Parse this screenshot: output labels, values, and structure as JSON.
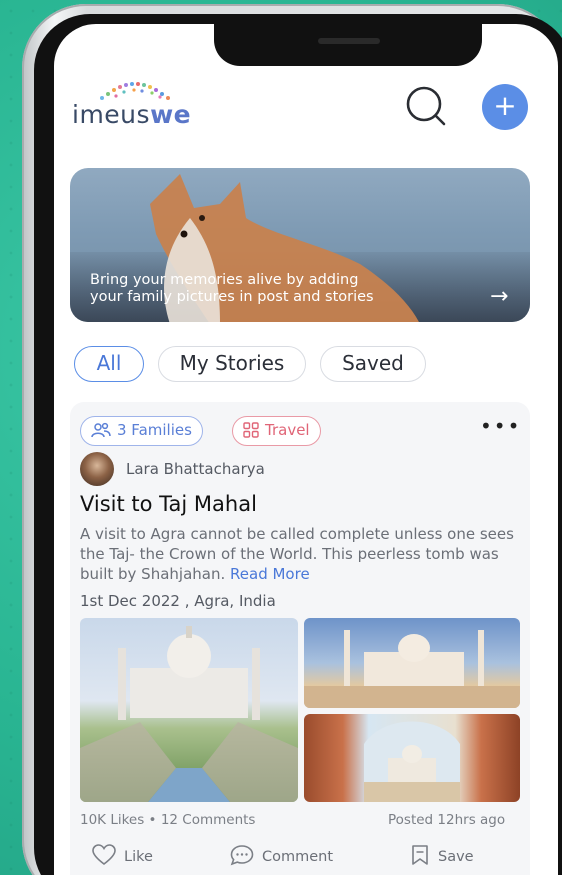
{
  "app": {
    "logo_text_a": "imeus",
    "logo_text_b": "we"
  },
  "header": {
    "search_icon": "search-icon",
    "add_icon": "plus-icon",
    "add_label": "+"
  },
  "banner": {
    "line1": "Bring your memories alive by adding",
    "line2": "your family pictures in post and stories",
    "arrow": "→"
  },
  "tabs": [
    {
      "label": "All",
      "active": true
    },
    {
      "label": "My Stories",
      "active": false
    },
    {
      "label": "Saved",
      "active": false
    }
  ],
  "post": {
    "chips": [
      {
        "label": "3 Families",
        "icon": "people-icon",
        "color": "#5a7fd6"
      },
      {
        "label": "Travel",
        "icon": "grid-icon",
        "color": "#e06577"
      }
    ],
    "more": "•••",
    "author": "Lara Bhattacharya",
    "title": "Visit to Taj Mahal",
    "description": "A visit to Agra cannot be called complete unless one sees the Taj- the Crown of the World. This peerless tomb was built by Shahjahan.",
    "read_more": "Read More",
    "date_location": "1st Dec 2022 , Agra, India",
    "stats": "10K Likes • 12 Comments",
    "posted": "Posted 12hrs ago",
    "actions": {
      "like": "Like",
      "comment": "Comment",
      "save": "Save"
    }
  },
  "colors": {
    "accent": "#5b8ee6",
    "background": "#2eb894"
  }
}
